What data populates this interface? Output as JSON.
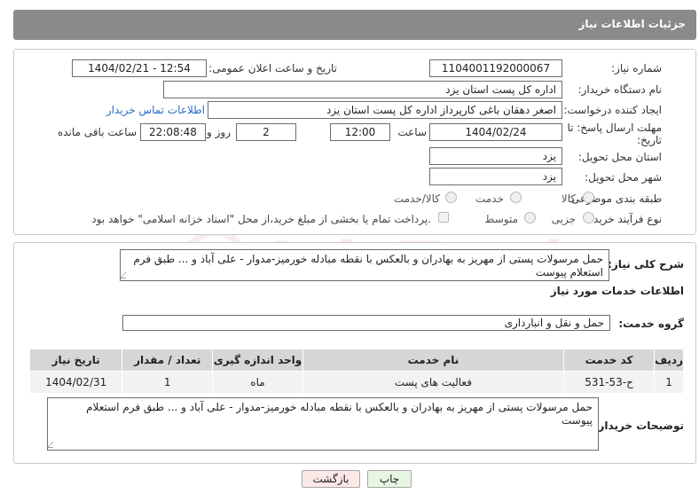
{
  "header": {
    "title": "جزئیات اطلاعات نیاز"
  },
  "form": {
    "need_number": {
      "label": "شماره نیاز:",
      "value": "1104001192000067"
    },
    "announce_datetime": {
      "label": "تاریخ و ساعت اعلان عمومی:",
      "value": "1404/02/21 - 12:54"
    },
    "buyer_org": {
      "label": "نام دستگاه خریدار:",
      "value": "اداره کل پست استان یزد"
    },
    "requester": {
      "label": "ایجاد کننده درخواست:",
      "value": "اصغر دهقان باغی کارپرداز اداره کل پست استان یزد",
      "contact_link": "اطلاعات تماس خریدار"
    },
    "deadline": {
      "label_line1": "مهلت ارسال پاسخ: تا",
      "label_line2": "تاریخ:",
      "date": "1404/02/24",
      "time_label": "ساعت",
      "time": "12:00",
      "days": "2",
      "days_label": "روز و",
      "remaining": "22:08:48",
      "remaining_label": "ساعت باقی مانده"
    },
    "delivery_province": {
      "label": "استان محل تحویل:",
      "value": "یزد"
    },
    "delivery_city": {
      "label": "شهر محل تحویل:",
      "value": "یزد"
    },
    "category": {
      "label": "طبقه بندی موضوعی:",
      "options": [
        "کالا",
        "خدمت",
        "کالا/خدمت"
      ]
    },
    "process_type": {
      "label": "نوع فرآیند خرید :",
      "options": [
        "جزیی",
        "متوسط"
      ],
      "payment_note": "پرداخت تمام یا بخشی از مبلغ خرید،از محل \"اسناد خزانه اسلامی\" خواهد بود."
    }
  },
  "summary": {
    "label": "شرح کلی نیاز:",
    "value": "حمل مرسولات پستی از مهریز به بهادران و بالعکس با نقطه مبادله خورمیز-مدوار - علی آباد و ...  طبق فرم استعلام پیوست"
  },
  "services": {
    "section_title": "اطلاعات خدمات مورد نیاز",
    "group_label": "گروه خدمت:",
    "group_value": "حمل و نقل و انبارداری",
    "columns": [
      "ردیف",
      "کد خدمت",
      "نام خدمت",
      "واحد اندازه گیری",
      "تعداد / مقدار",
      "تاریخ نیاز"
    ],
    "rows": [
      {
        "row": "1",
        "code": "ح-53-531",
        "name": "فعالیت های پست",
        "unit": "ماه",
        "qty": "1",
        "date": "1404/02/31"
      }
    ]
  },
  "buyer_notes": {
    "label": "توضیحات خریدار:",
    "value": "حمل مرسولات پستی از مهریز به بهادران و بالعکس با نقطه مبادله خورمیز-مدوار - علی آباد و ...  طبق فرم استعلام پیوست"
  },
  "buttons": {
    "print": "چاپ",
    "back": "بازگشت"
  },
  "watermark": {
    "text": "AriaTender.net"
  },
  "colors": {
    "title_bar": "#8a8a8a",
    "link": "#2a6cc9",
    "back_button": "#fde8e8",
    "print_button": "#e6f6e0"
  }
}
